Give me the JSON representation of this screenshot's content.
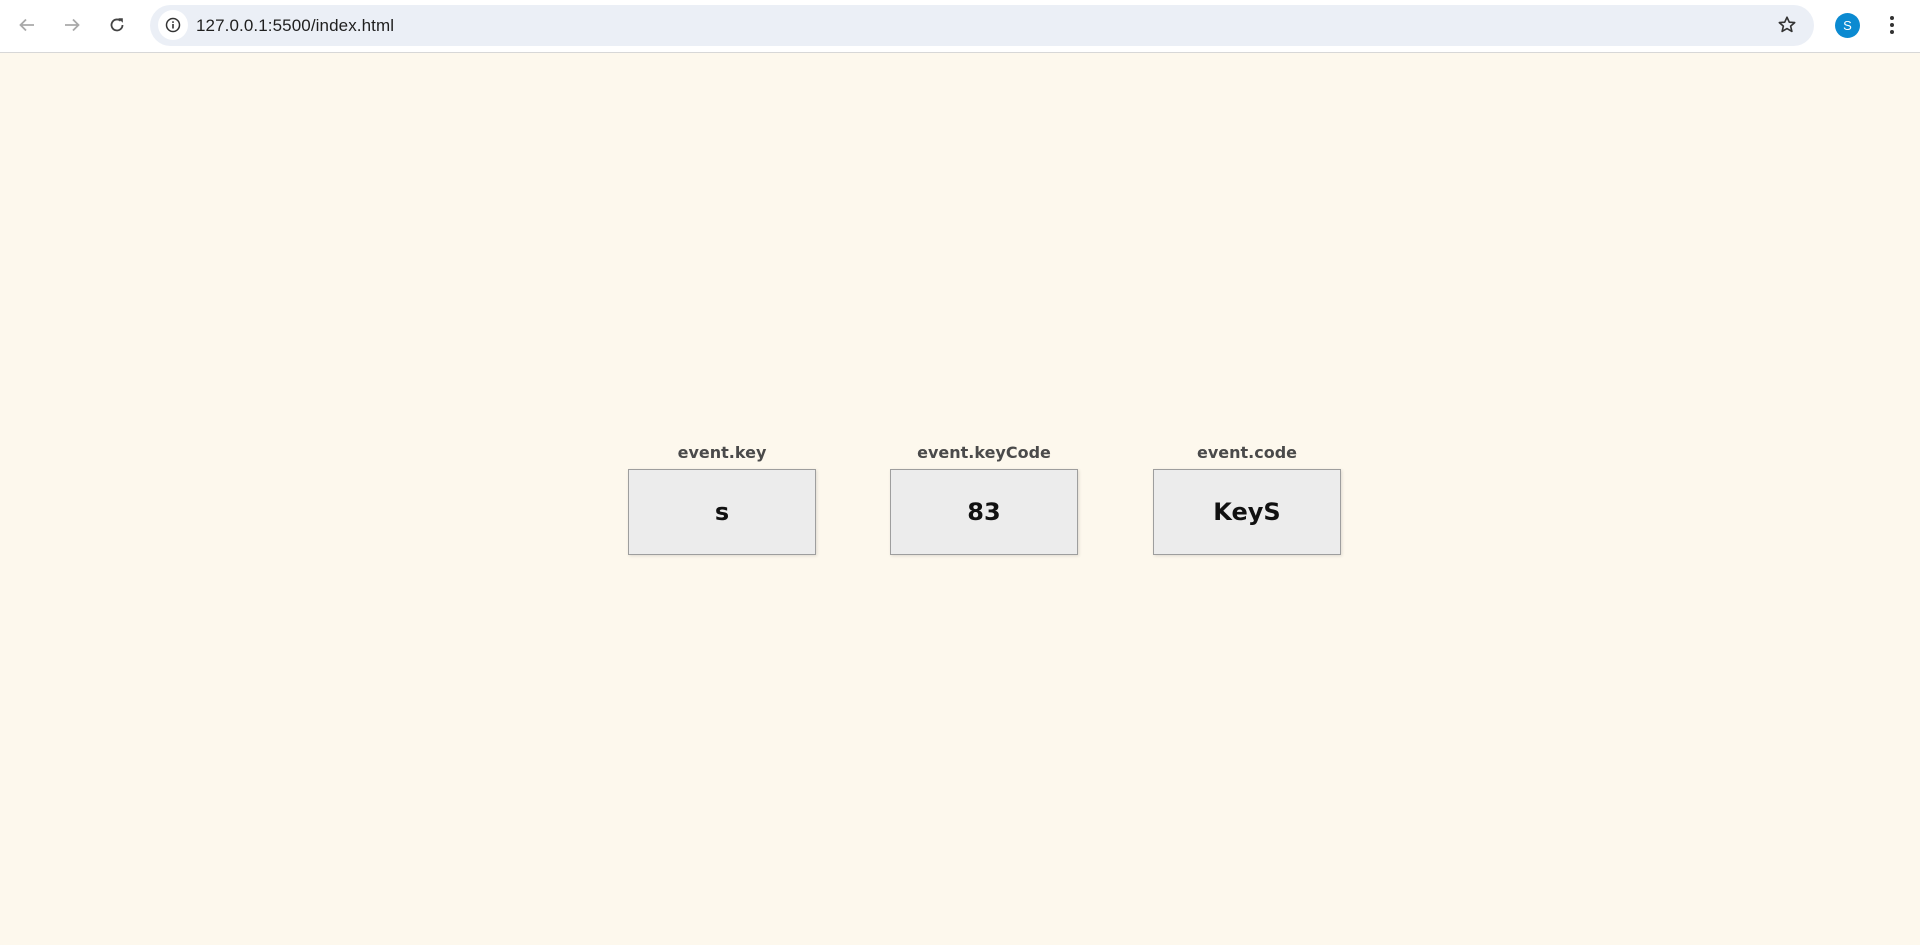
{
  "browser": {
    "url": "127.0.0.1:5500/index.html",
    "profile_initial": "S",
    "profile_color": "#0b8ad1",
    "icons": {
      "back": "arrow-left-icon",
      "forward": "arrow-right-icon",
      "reload": "reload-icon",
      "site_info": "info-icon",
      "bookmark": "star-icon",
      "menu": "kebab-menu-icon"
    }
  },
  "page": {
    "background": "#fdf8ed",
    "cards": [
      {
        "label": "event.key",
        "value": "s"
      },
      {
        "label": "event.keyCode",
        "value": "83"
      },
      {
        "label": "event.code",
        "value": "KeyS"
      }
    ]
  }
}
